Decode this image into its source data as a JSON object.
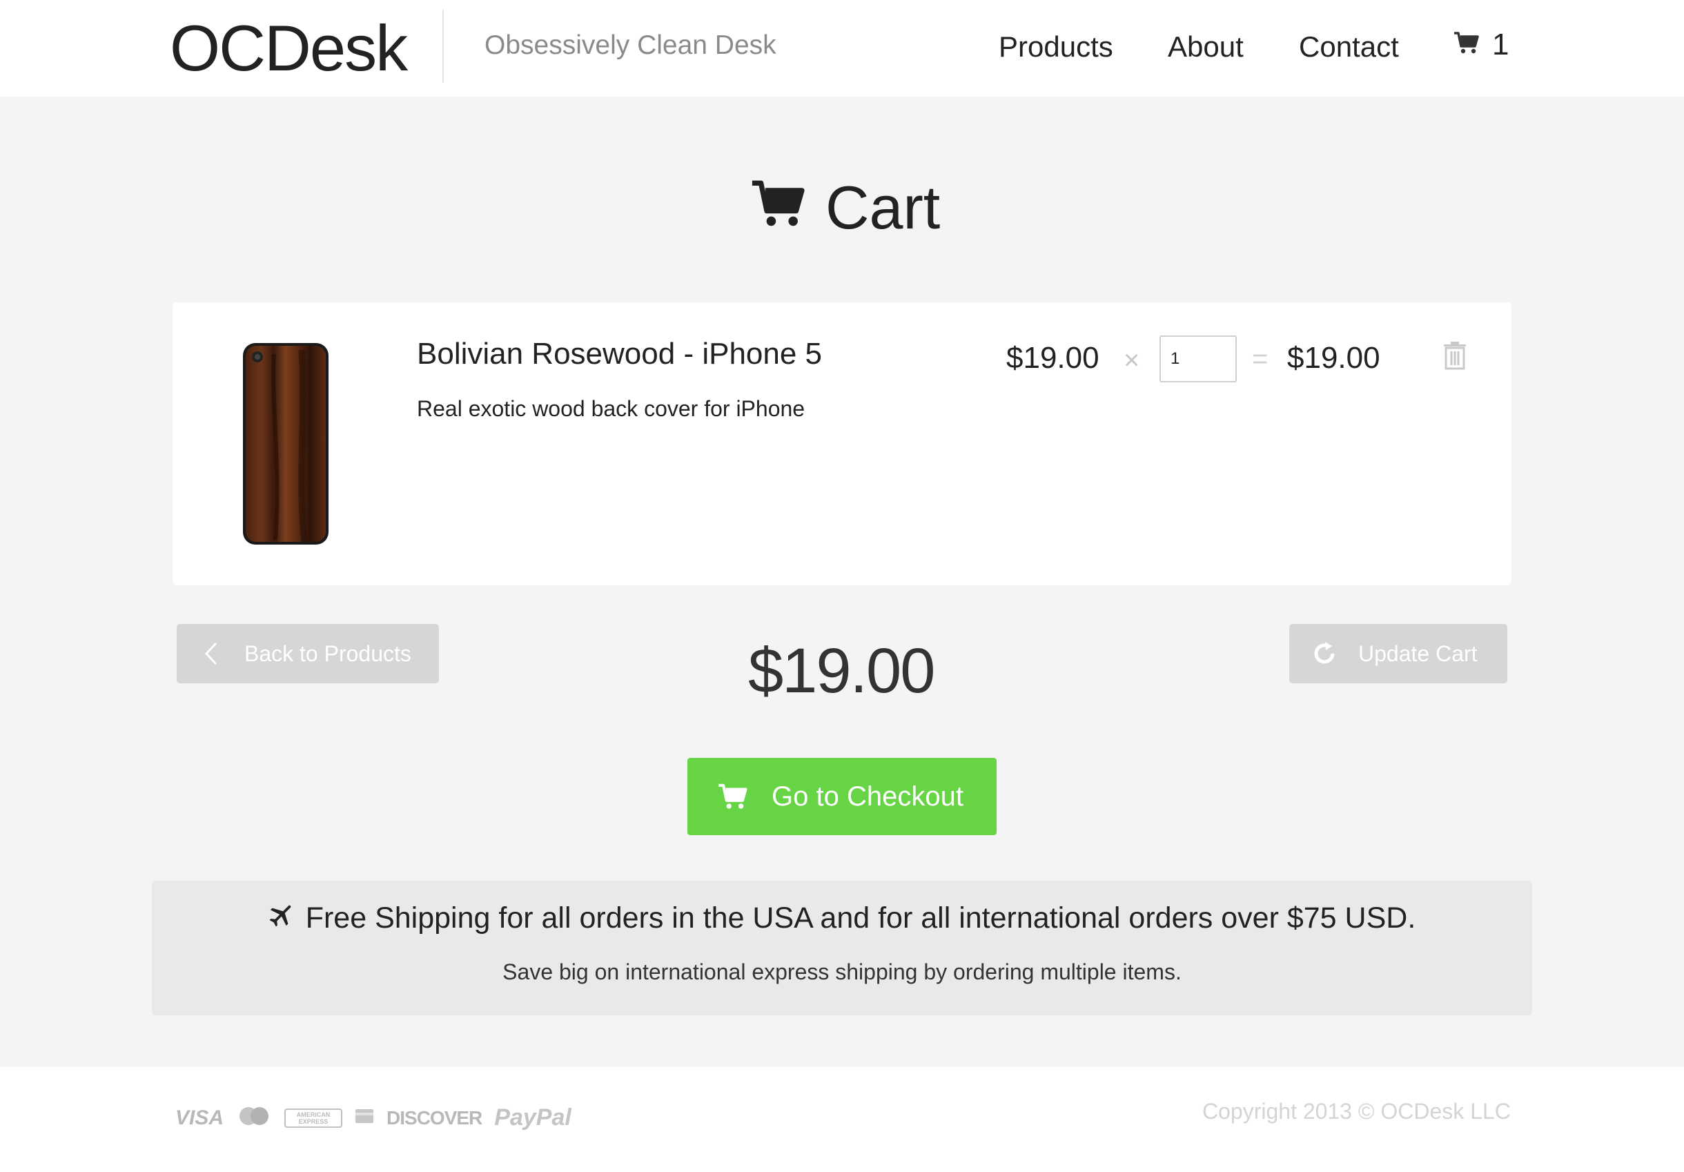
{
  "header": {
    "logo": "OCDesk",
    "tagline": "Obsessively Clean Desk",
    "nav": [
      "Products",
      "About",
      "Contact"
    ],
    "cart_count": "1"
  },
  "page": {
    "title": "Cart"
  },
  "cart": {
    "items": [
      {
        "name": "Bolivian Rosewood - iPhone 5",
        "description": "Real exotic wood back cover for iPhone",
        "unit_price": "$19.00",
        "times": "×",
        "quantity": "1",
        "equals": "=",
        "line_total": "$19.00"
      }
    ],
    "total": "$19.00"
  },
  "buttons": {
    "back": "Back to Products",
    "update": "Update Cart",
    "checkout": "Go to Checkout"
  },
  "shipping": {
    "title": "Free Shipping for all orders in the USA and for all international orders over $75 USD.",
    "subtitle": "Save big on international express shipping by ordering multiple items."
  },
  "footer": {
    "payment_logos": [
      "VISA",
      "MasterCard",
      "AMERICAN EXPRESS",
      "Card",
      "DISCOVER",
      "PayPal"
    ],
    "copyright": "Copyright 2013 © OCDesk LLC"
  },
  "colors": {
    "accent_green": "#67d446",
    "button_grey": "#d6d6d6",
    "background": "#f4f4f4"
  }
}
